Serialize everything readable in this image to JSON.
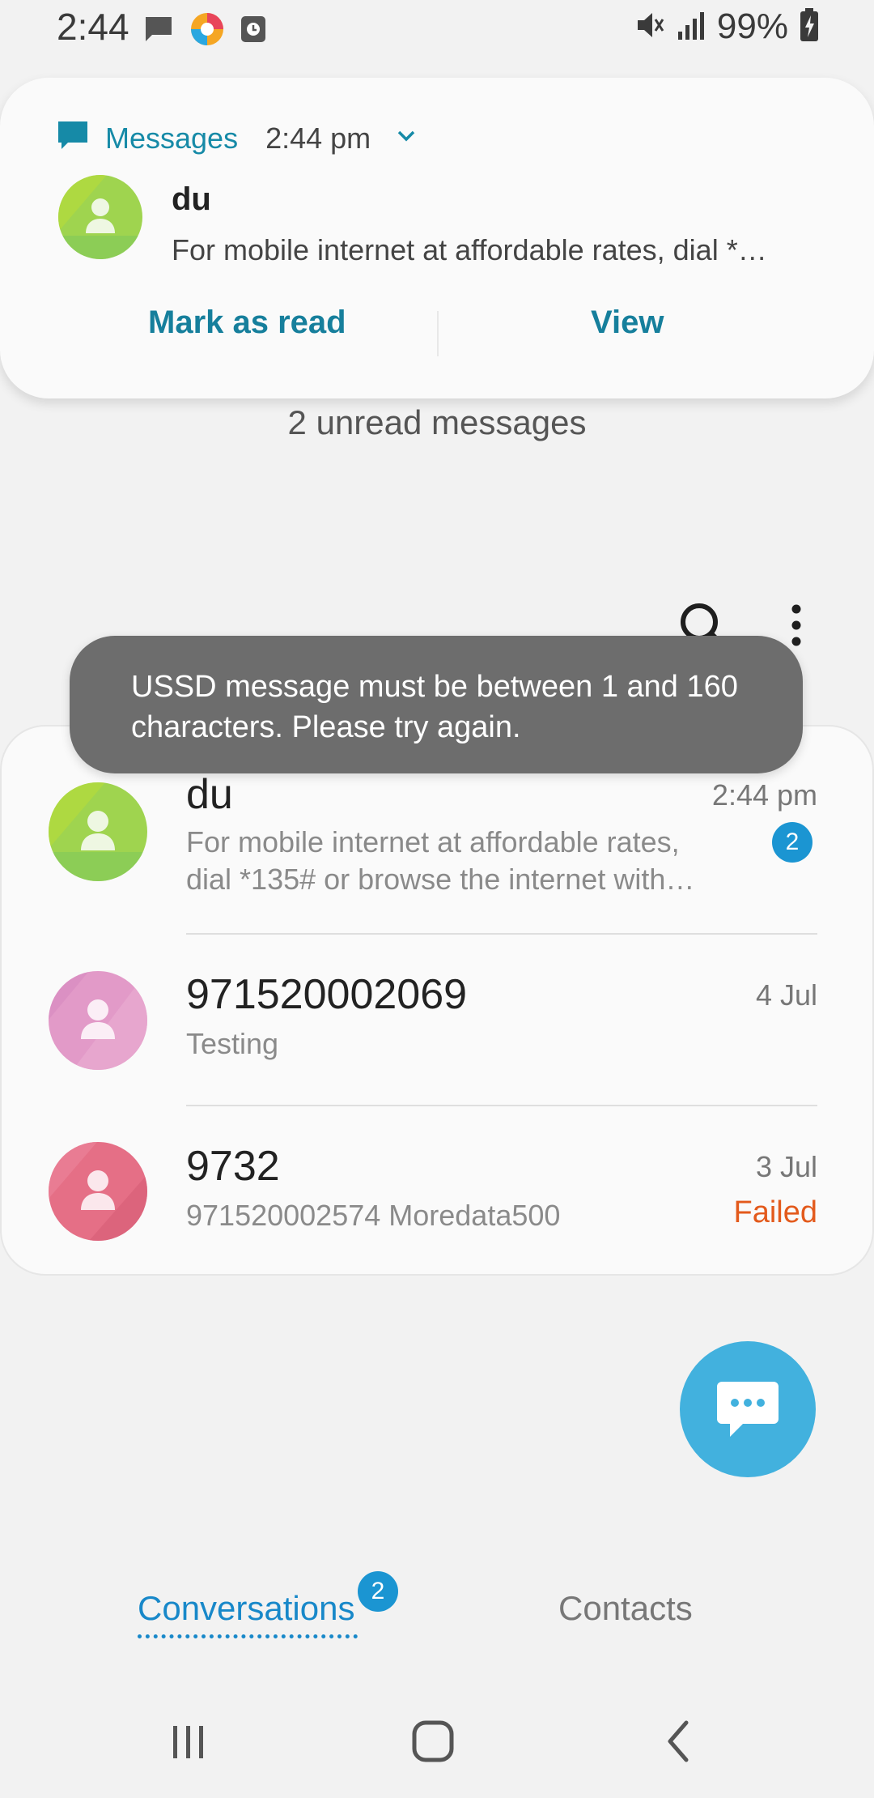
{
  "status_bar": {
    "time": "2:44",
    "battery_text": "99%",
    "icons_left": [
      "message-icon",
      "app-icon",
      "clock-app-icon"
    ],
    "icons_right": [
      "mute-icon",
      "signal-icon",
      "battery-charging-icon"
    ]
  },
  "notification": {
    "app_name": "Messages",
    "time": "2:44 pm",
    "sender": "du",
    "preview": "For mobile internet at affordable rates, dial *…",
    "actions": {
      "mark_read": "Mark as read",
      "view": "View"
    }
  },
  "unread_summary": "2 unread messages",
  "toast": "USSD message must be between 1 and 160 characters. Please try again.",
  "conversations": [
    {
      "name": "du",
      "date": "2:44 pm",
      "preview_line1": "For mobile internet at affordable rates,",
      "preview_line2": "dial *135# or browse the internet with…",
      "badge": "2",
      "avatar_color": "#9fd44f"
    },
    {
      "name": "971520002069",
      "date": "4 Jul",
      "preview_line1": "Testing",
      "avatar_color": "#e29ac8"
    },
    {
      "name": "9732",
      "date": "3 Jul",
      "preview_line1": "971520002574 Moredata500",
      "status": "Failed",
      "avatar_color": "#e56f86"
    }
  ],
  "tabs": {
    "conversations": "Conversations",
    "conversations_badge": "2",
    "contacts": "Contacts"
  },
  "colors": {
    "accent": "#1888c9",
    "notification_accent": "#167f9c",
    "fab": "#42b1de",
    "failed": "#e35a1c",
    "toast_bg": "#6d6d6d"
  }
}
